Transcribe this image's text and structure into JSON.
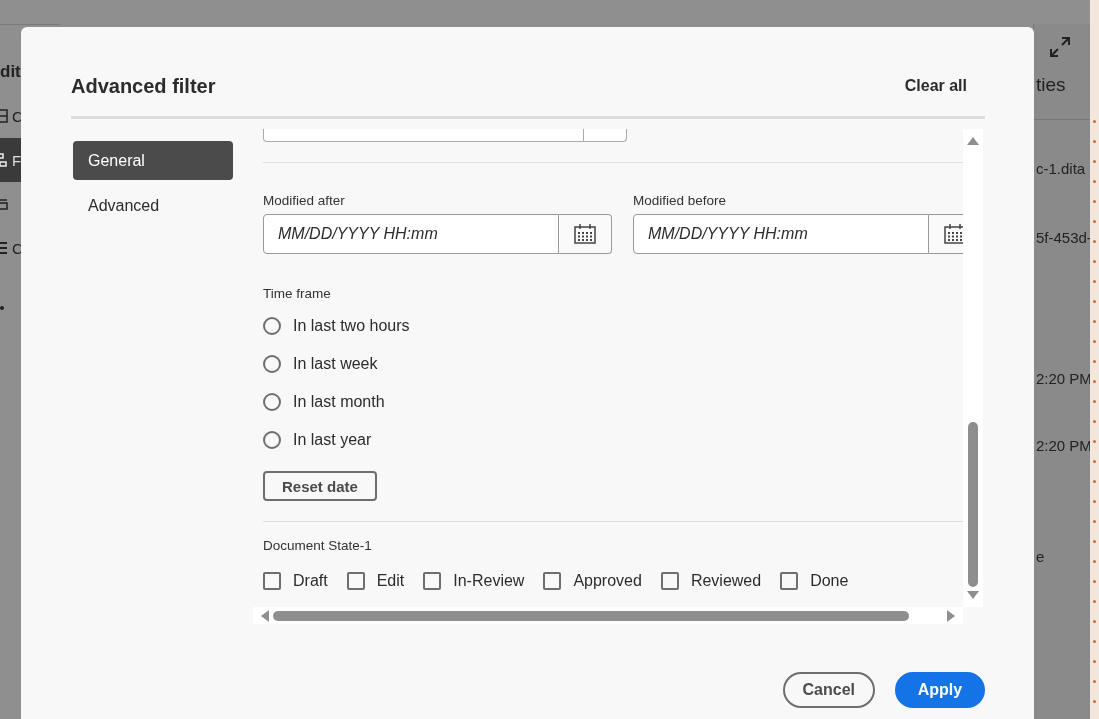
{
  "background": {
    "panel_title": "dit",
    "left_items": [
      {
        "kind": "grid",
        "label": "C",
        "selected": false
      },
      {
        "kind": "tree",
        "label": "F",
        "selected": true
      },
      {
        "kind": "map",
        "selected": false
      },
      {
        "kind": "list",
        "label": "C",
        "selected": false
      },
      {
        "kind": "bullet",
        "selected": false
      }
    ],
    "properties_title": "ties",
    "properties_values": [
      "c-1.dita",
      "5f-453d-",
      "2:20 PM",
      "2:20 PM",
      "e"
    ]
  },
  "dialog": {
    "title": "Advanced filter",
    "clear_all": "Clear all",
    "nav": [
      {
        "label": "General",
        "selected": true
      },
      {
        "label": "Advanced",
        "selected": false
      }
    ],
    "date_fields": [
      {
        "label": "Modified after",
        "placeholder": "MM/DD/YYYY HH:mm"
      },
      {
        "label": "Modified before",
        "placeholder": "MM/DD/YYYY HH:mm"
      }
    ],
    "time_frame": {
      "label": "Time frame",
      "options": [
        {
          "label": "In last two hours",
          "selected": false
        },
        {
          "label": "In last week",
          "selected": false
        },
        {
          "label": "In last month",
          "selected": false
        },
        {
          "label": "In last year",
          "selected": false
        }
      ]
    },
    "reset_button": "Reset date",
    "document_state": {
      "label": "Document State-1",
      "options": [
        {
          "label": "Draft",
          "checked": false
        },
        {
          "label": "Edit",
          "checked": false
        },
        {
          "label": "In-Review",
          "checked": false
        },
        {
          "label": "Approved",
          "checked": false
        },
        {
          "label": "Reviewed",
          "checked": false
        },
        {
          "label": "Done",
          "checked": false
        }
      ]
    },
    "buttons": [
      {
        "label": "Cancel",
        "kind": "secondary"
      },
      {
        "label": "Apply",
        "kind": "primary"
      }
    ]
  }
}
